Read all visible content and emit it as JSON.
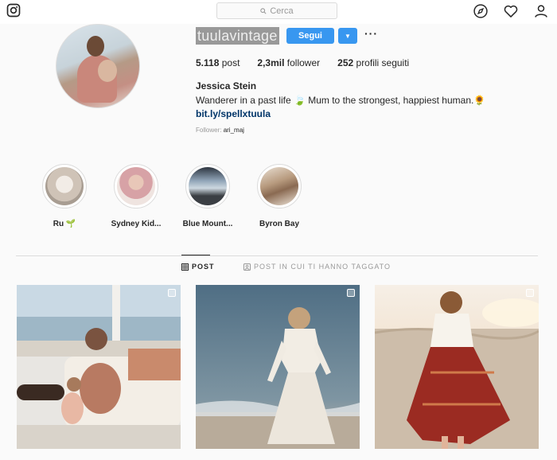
{
  "header": {
    "search_placeholder": "Cerca",
    "icons": [
      "instagram-logo-icon",
      "search-icon",
      "compass-icon",
      "heart-icon",
      "profile-icon"
    ]
  },
  "profile": {
    "username": "tuulavintage",
    "follow_label": "Segui",
    "more_label": "···",
    "stats": {
      "posts_count": "5.118",
      "posts_label": "post",
      "followers_count": "2,3mil",
      "followers_label": "follower",
      "following_count": "252",
      "following_label": "profili seguiti"
    },
    "full_name": "Jessica Stein",
    "bio": "Wanderer in a past life 🍃 Mum to the strongest, happiest human.🌻",
    "link": "bit.ly/spellxtuula",
    "followed_by_label": "Follower:",
    "followed_by_name": "ari_maj"
  },
  "highlights": [
    {
      "label": "Ru 🌱"
    },
    {
      "label": "Sydney Kid..."
    },
    {
      "label": "Blue Mount..."
    },
    {
      "label": "Byron Bay"
    }
  ],
  "tabs": {
    "posts_label": "POST",
    "tagged_label": "POST IN CUI TI HANNO TAGGATO"
  },
  "colors": {
    "accent": "#3897f0",
    "link": "#003569",
    "text": "#262626",
    "muted": "#999999"
  }
}
